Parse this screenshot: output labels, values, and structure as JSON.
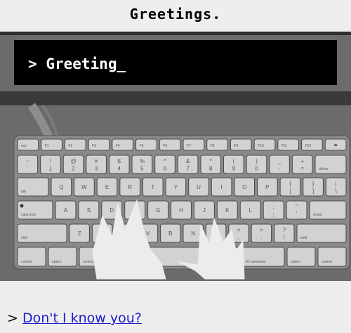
{
  "page": {
    "title": "Greetings."
  },
  "terminal": {
    "prompt": ">",
    "text": "Greeting_"
  },
  "keyboard": {
    "fn_row": [
      "esc",
      "F1",
      "F2",
      "F3",
      "F4",
      "F5",
      "F6",
      "F7",
      "F8",
      "F9",
      "F10",
      "F11",
      "F12",
      "⏏"
    ],
    "num_row": [
      [
        "~",
        "`"
      ],
      [
        "!",
        "1"
      ],
      [
        "@",
        "2"
      ],
      [
        "#",
        "3"
      ],
      [
        "$",
        "4"
      ],
      [
        "%",
        "5"
      ],
      [
        "^",
        "6"
      ],
      [
        "&",
        "7"
      ],
      [
        "*",
        "8"
      ],
      [
        "(",
        "9"
      ],
      [
        ")",
        "0"
      ],
      [
        "_",
        "-"
      ],
      [
        "+",
        "="
      ],
      [
        "",
        "delete"
      ]
    ],
    "q_row": [
      [
        "",
        "tab"
      ],
      [
        "",
        "Q"
      ],
      [
        "",
        "W"
      ],
      [
        "",
        "E"
      ],
      [
        "",
        "R"
      ],
      [
        "",
        "T"
      ],
      [
        "",
        "Y"
      ],
      [
        "",
        "U"
      ],
      [
        "",
        "I"
      ],
      [
        "",
        "O"
      ],
      [
        "",
        "P"
      ],
      [
        "{",
        "["
      ],
      [
        "}",
        "]"
      ],
      [
        "|",
        "\\"
      ]
    ],
    "a_row": [
      [
        "",
        "caps lock"
      ],
      [
        "",
        "A"
      ],
      [
        "",
        "S"
      ],
      [
        "",
        "D"
      ],
      [
        "",
        "F"
      ],
      [
        "",
        "G"
      ],
      [
        "",
        "H"
      ],
      [
        "",
        "J"
      ],
      [
        "",
        "K"
      ],
      [
        "",
        "L"
      ],
      [
        ":",
        ";"
      ],
      [
        "\"",
        "'"
      ],
      [
        "",
        "return"
      ]
    ],
    "z_row": [
      [
        "",
        "shift"
      ],
      [
        "",
        "Z"
      ],
      [
        "",
        "X"
      ],
      [
        "",
        "C"
      ],
      [
        "",
        "V"
      ],
      [
        "",
        "B"
      ],
      [
        "",
        "N"
      ],
      [
        "",
        "M"
      ],
      [
        "<",
        ","
      ],
      [
        ">",
        "."
      ],
      [
        "?",
        "/"
      ],
      [
        "",
        "shift"
      ]
    ],
    "bottom_row": [
      "control",
      "option",
      "command",
      "",
      "⌘ command",
      "option",
      "control"
    ]
  },
  "link": {
    "prompt": ">",
    "text": "Don't I know you?"
  }
}
